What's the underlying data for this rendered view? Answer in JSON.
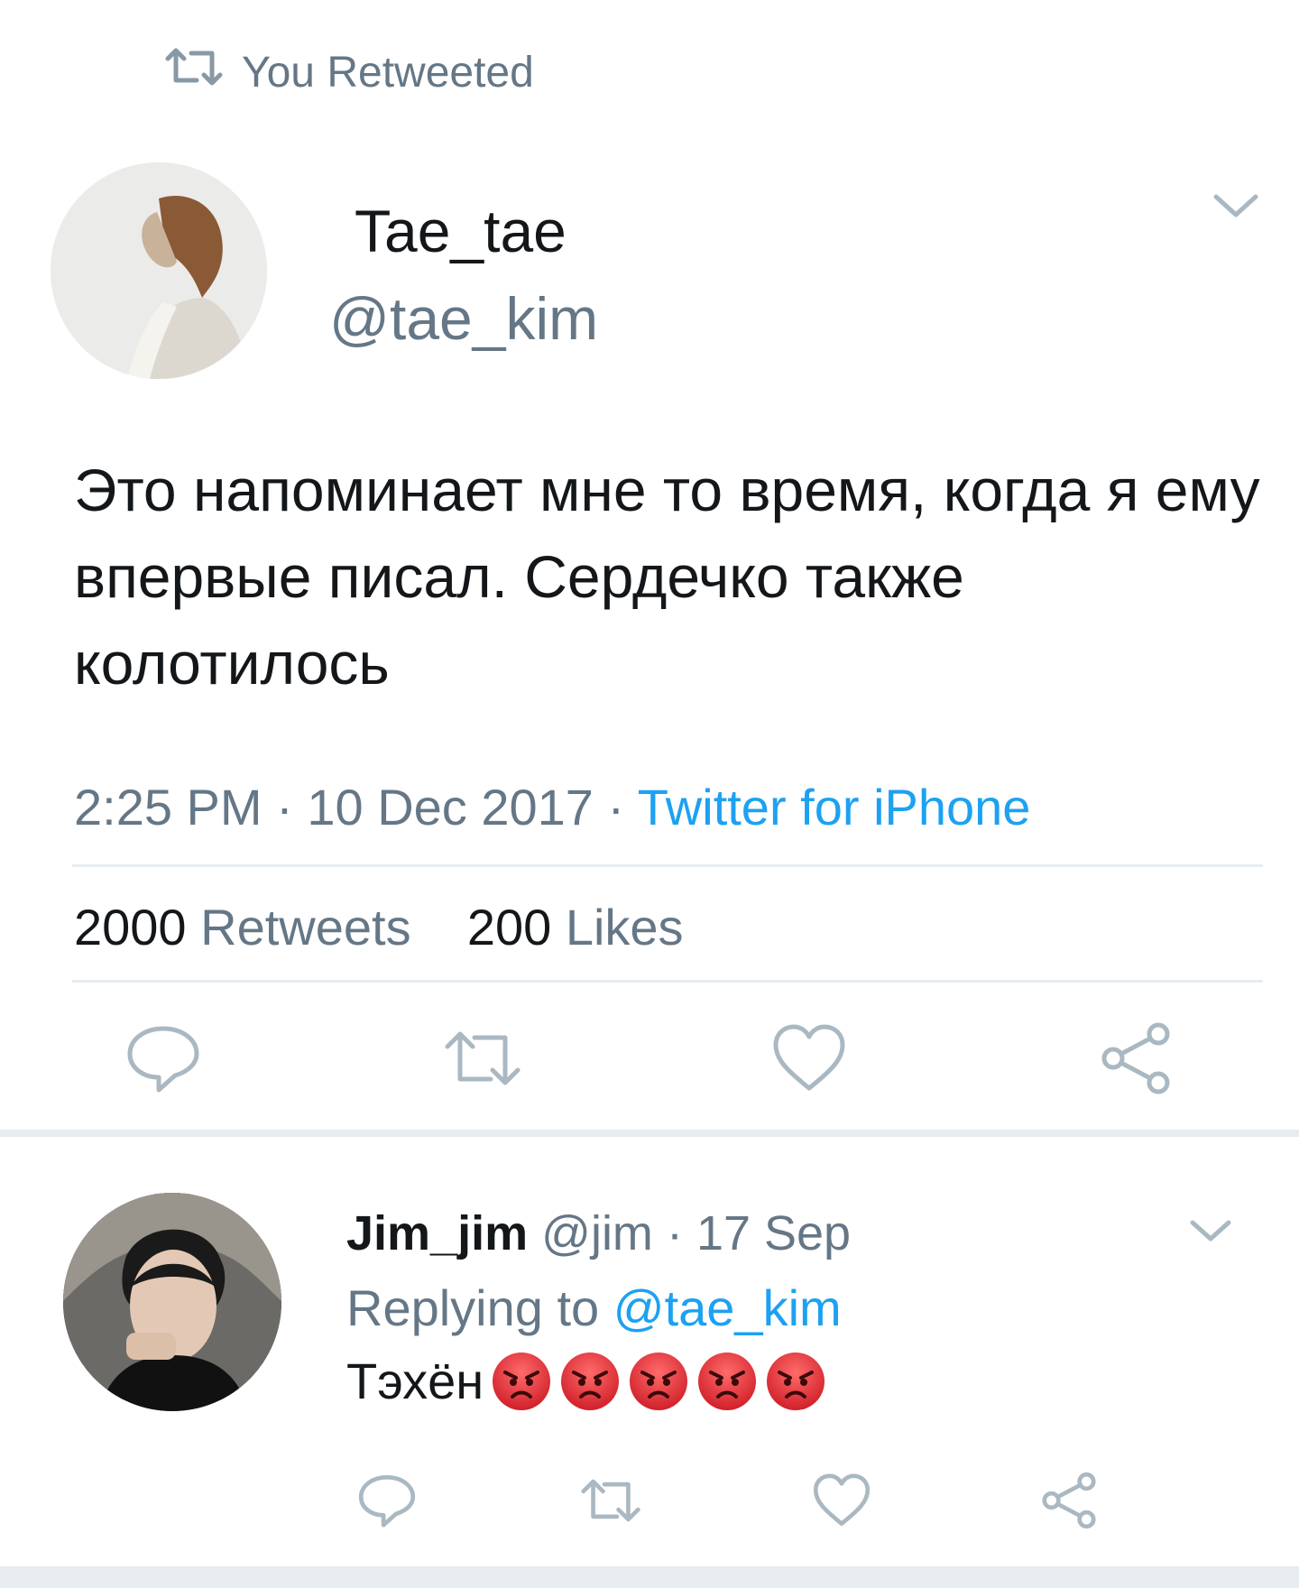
{
  "retweet_header": {
    "label": "You Retweeted"
  },
  "tweet": {
    "display_name": "Tae_tae",
    "handle": "@tae_kim",
    "text": "Это напоминает мне то время, когда я ему впервые писал. Сердечко также колотилось",
    "time": "2:25 PM",
    "date": "10 Dec 2017",
    "separator": "·",
    "source": "Twitter for iPhone",
    "retweets_count": "2000",
    "retweets_label": "Retweets",
    "likes_count": "200",
    "likes_label": "Likes"
  },
  "reply": {
    "display_name": "Jim_jim",
    "handle": "@jim",
    "separator": "·",
    "date": "17 Sep",
    "replying_to_label": "Replying to",
    "replying_to_handle": "@tae_kim",
    "text": "Тэхён",
    "emoji_count": 5,
    "emoji_name": "angry-face"
  },
  "colors": {
    "link": "#1da1f2",
    "muted": "#657786",
    "text": "#14171a",
    "divider": "#e6ecf0",
    "icon": "#8899a6"
  },
  "icons": [
    "retweet-icon",
    "chevron-down-icon",
    "reply-icon",
    "like-icon",
    "share-icon",
    "angry-face-emoji"
  ]
}
